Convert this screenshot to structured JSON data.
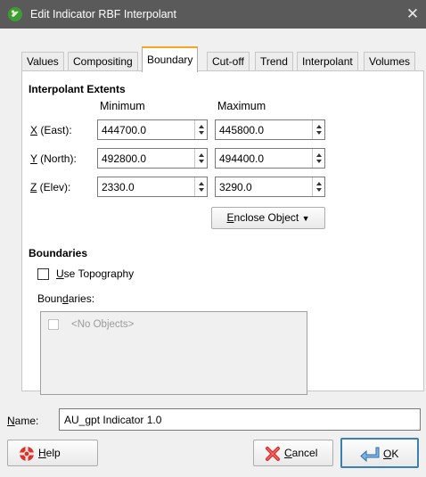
{
  "window": {
    "title": "Edit Indicator RBF Interpolant",
    "app_icon": "leapfrog-app-icon",
    "close_icon": "close-icon",
    "close_glyph": "✕"
  },
  "tabs": [
    {
      "label": "Values",
      "active": false
    },
    {
      "label": "Compositing",
      "active": false
    },
    {
      "label": "Boundary",
      "active": true
    },
    {
      "label": "Cut-off",
      "active": false
    },
    {
      "label": "Trend",
      "active": false
    },
    {
      "label": "Interpolant",
      "active": false
    },
    {
      "label": "Volumes",
      "active": false
    }
  ],
  "extents": {
    "title": "Interpolant Extents",
    "min_header": "Minimum",
    "max_header": "Maximum",
    "rows": [
      {
        "mnemonic": "X",
        "label_rest": " (East):",
        "min": "444700.0",
        "max": "445800.0"
      },
      {
        "mnemonic": "Y",
        "label_rest": " (North):",
        "min": "492800.0",
        "max": "494400.0"
      },
      {
        "mnemonic": "Z",
        "label_rest": " (Elev):",
        "min": "2330.0",
        "max": "3290.0"
      }
    ],
    "enclose_button": {
      "mnemonic": "E",
      "rest": "nclose Object",
      "dropdown_glyph": "▼"
    }
  },
  "boundaries": {
    "title": "Boundaries",
    "use_topography": {
      "mnemonic": "U",
      "rest": "se Topography",
      "checked": false
    },
    "list_label": {
      "pre": "Boun",
      "mnemonic": "d",
      "post": "aries:"
    },
    "empty_item": "<No Objects>"
  },
  "name": {
    "mnemonic": "N",
    "rest": "ame:",
    "value": "AU_gpt Indicator 1.0"
  },
  "buttons": {
    "help": {
      "mnemonic": "H",
      "rest": "elp",
      "icon": "help-icon"
    },
    "cancel": {
      "mnemonic": "C",
      "rest": "ancel",
      "icon": "cancel-icon"
    },
    "ok": {
      "mnemonic": "O",
      "rest": "K",
      "icon": "ok-arrow-icon"
    }
  },
  "colors": {
    "title_bar": "#5a5a5a",
    "active_tab_accent": "#f5a623",
    "ok_border": "#3c7fb1"
  }
}
